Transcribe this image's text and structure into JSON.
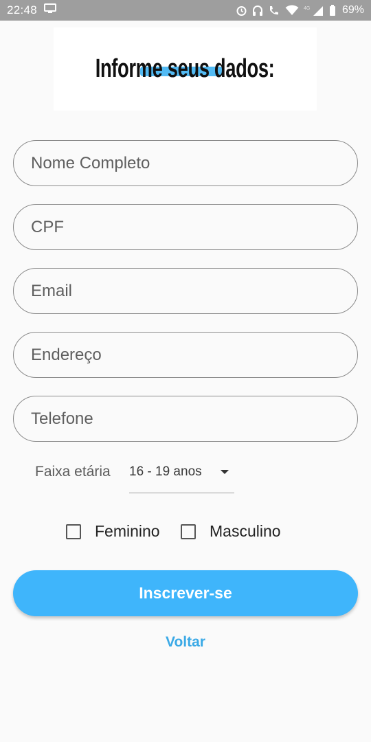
{
  "status_bar": {
    "time": "22:48",
    "battery_pct": "69%",
    "icons": [
      "screen-cast-icon",
      "alarm-icon",
      "headset-icon",
      "volte-call-icon",
      "wifi-icon",
      "signal-4g-icon",
      "battery-icon"
    ],
    "network_label": "4G"
  },
  "header": {
    "title": "Informe seus dados:",
    "accent_color": "#3fb3f2"
  },
  "form": {
    "name_placeholder": "Nome Completo",
    "cpf_placeholder": "CPF",
    "email_placeholder": "Email",
    "address_placeholder": "Endereço",
    "phone_placeholder": "Telefone",
    "age_label": "Faixa etária",
    "age_selected": "16 - 19 anos",
    "gender_options": {
      "female": "Feminino",
      "male": "Masculino"
    },
    "submit_label": "Inscrever-se",
    "back_label": "Voltar"
  },
  "colors": {
    "primary": "#3fb5fb",
    "link": "#3aa9e6",
    "status_bar": "#9e9e9e",
    "background": "#fafafa"
  }
}
